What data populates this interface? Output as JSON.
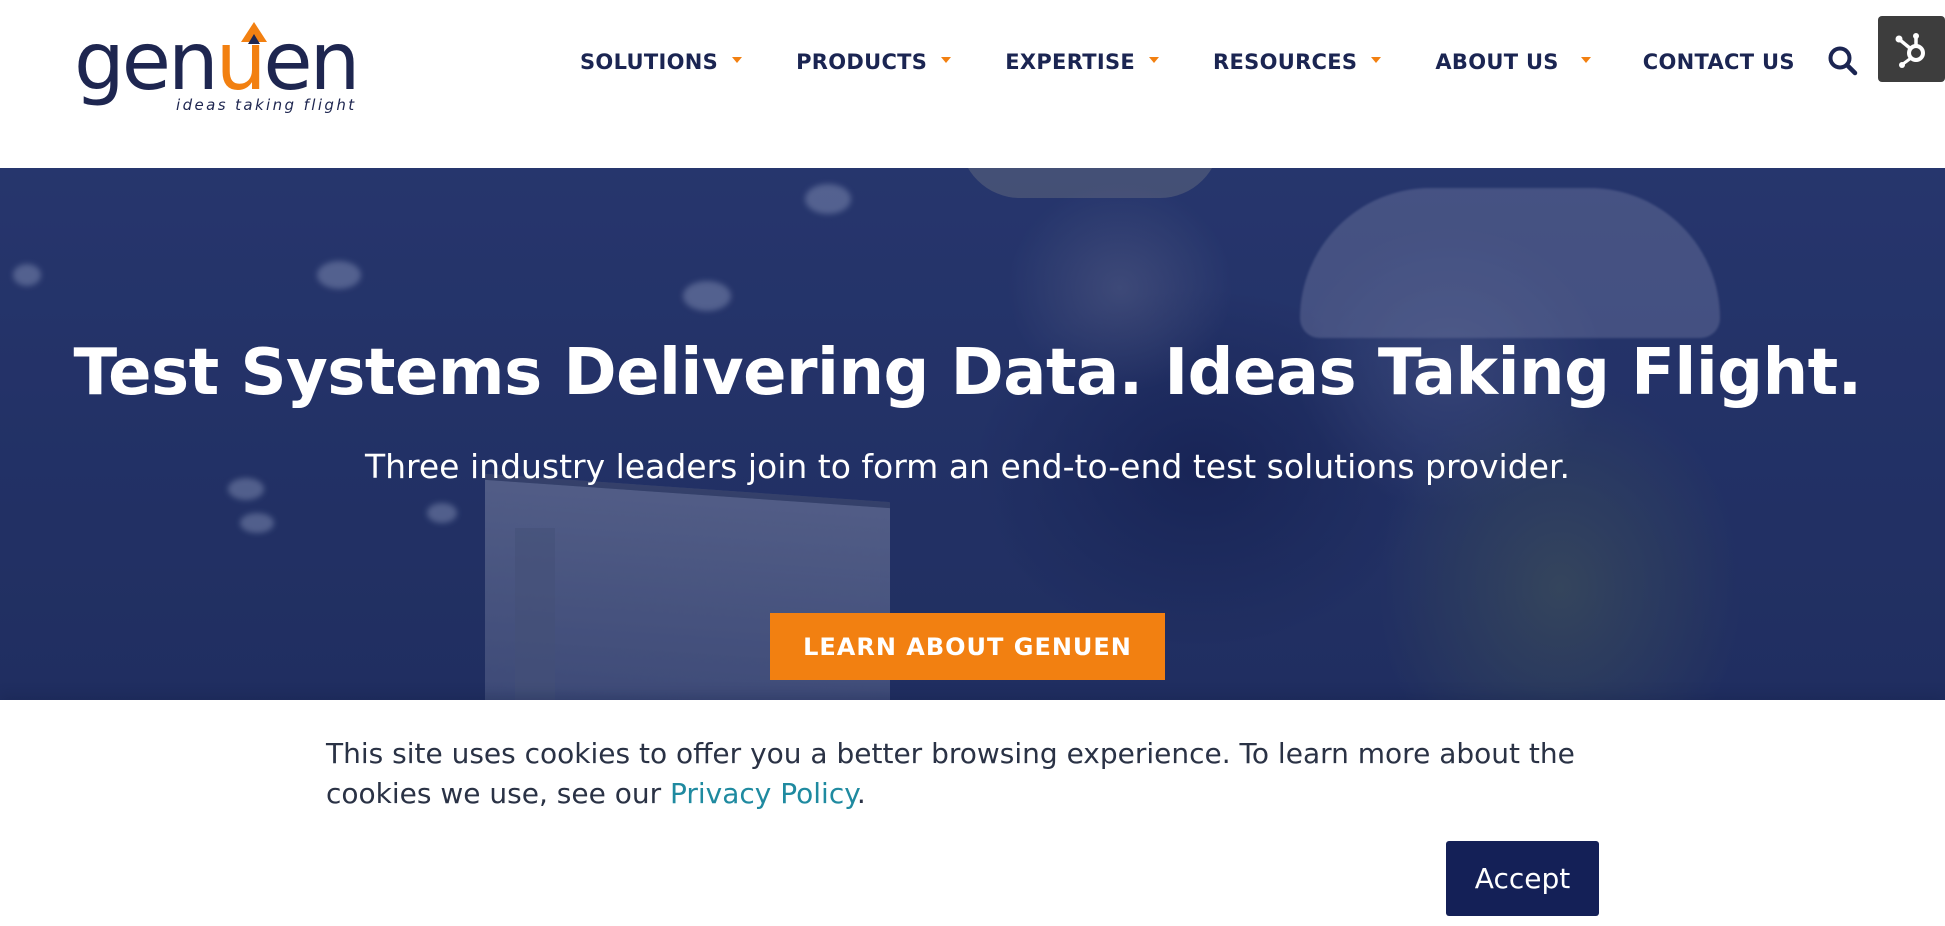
{
  "brand": {
    "logo_prefix": "gen",
    "logo_u": "u",
    "logo_suffix": "en",
    "tagline": "ideas taking flight",
    "primary_color": "#1b2552",
    "accent_color": "#f28011"
  },
  "nav": {
    "items": [
      {
        "label": "SOLUTIONS",
        "has_dropdown": true
      },
      {
        "label": "PRODUCTS",
        "has_dropdown": true
      },
      {
        "label": "EXPERTISE",
        "has_dropdown": true
      },
      {
        "label": "RESOURCES",
        "has_dropdown": true
      },
      {
        "label": "ABOUT US",
        "has_dropdown": true
      },
      {
        "label": "CONTACT US",
        "has_dropdown": false
      }
    ],
    "search_icon": "search-icon",
    "hubspot_icon": "hubspot-sprocket-icon"
  },
  "hero": {
    "title": "Test Systems Delivering Data. Ideas Taking Flight.",
    "subtitle": "Three industry leaders join to form an end-to-end test solutions provider.",
    "cta_label": "LEARN ABOUT GENUEN"
  },
  "cookie_banner": {
    "text_before_link": "This site uses cookies to offer you a better browsing experience. To learn more about the cookies we use, see our ",
    "link_text": "Privacy Policy",
    "text_after_link": ".",
    "accept_label": "Accept"
  }
}
